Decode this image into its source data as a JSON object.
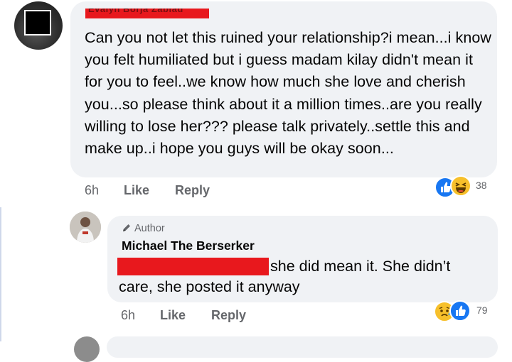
{
  "comment1": {
    "author_name": "Evalyn Borja Zabiad",
    "text": "Can you not let this ruined your relationship?i mean...i know you felt humiliated but i guess madam kilay didn't mean it for you to feel..we know how much she love and cherish you...so please think about it a million times..are you really willing to lose her??? please talk privately..settle this and make up..i hope you guys will be okay soon...",
    "time": "6h",
    "like_label": "Like",
    "reply_label": "Reply",
    "reactions": [
      "like-icon",
      "haha-icon"
    ],
    "reaction_count": "38"
  },
  "comment2": {
    "badge": "Author",
    "author_name": "Michael The Berserker",
    "text_line1": "she did mean it. She didn’t",
    "text_line2": "care, she posted it anyway",
    "time": "6h",
    "like_label": "Like",
    "reply_label": "Reply",
    "reactions": [
      "sad-icon",
      "like-icon"
    ],
    "reaction_count": "79"
  },
  "colors": {
    "bubble": "#f0f2f5",
    "redaction": "#e8181d",
    "meta_text": "#65676b",
    "like_blue": "#1877f2",
    "emoji_yellow": "#f7c02b"
  }
}
